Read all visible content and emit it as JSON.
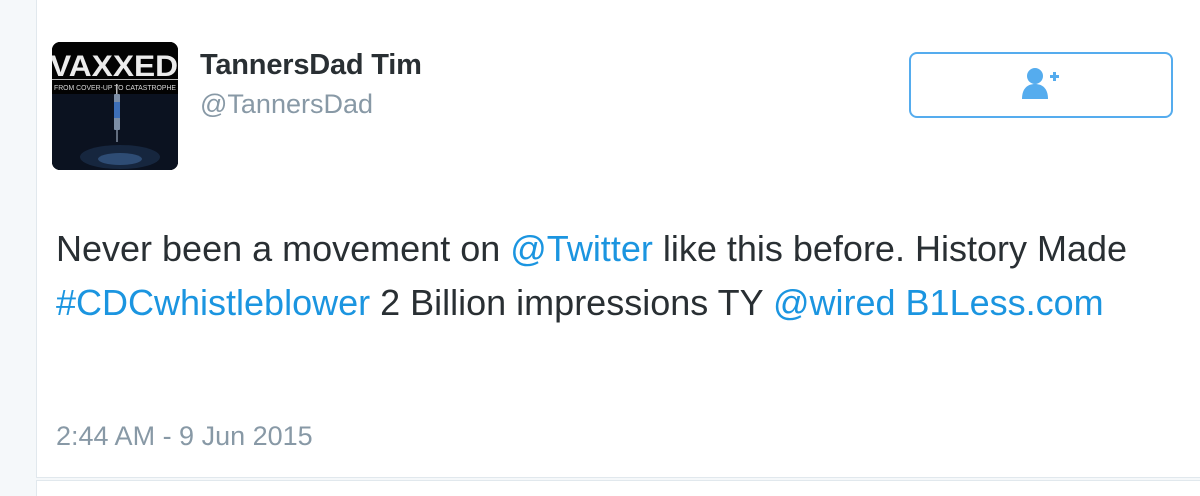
{
  "user": {
    "display_name": "TannersDad Tim",
    "handle": "@TannersDad",
    "avatar": {
      "title_text": "VAXXED",
      "subtitle_text": "FROM COVER-UP TO CATASTROPHE"
    }
  },
  "follow_button": {
    "icon": "follow-person-plus-icon",
    "color": "#55acee"
  },
  "tweet": {
    "text": {
      "p1": "Never been a movement on ",
      "mention_twitter": "@Twitter",
      "p2": " like this before. History Made ",
      "hashtag": "#CDCwhistleblower",
      "p3": " 2 Billion impressions TY ",
      "mention_wired": "@wired",
      "p4": " ",
      "link": "B1Less.com"
    },
    "timestamp": "2:44 AM - 9 Jun 2015"
  },
  "colors": {
    "link": "#1b95e0",
    "text": "#292f33",
    "muted": "#8899a6",
    "background": "#f5f8fa"
  }
}
